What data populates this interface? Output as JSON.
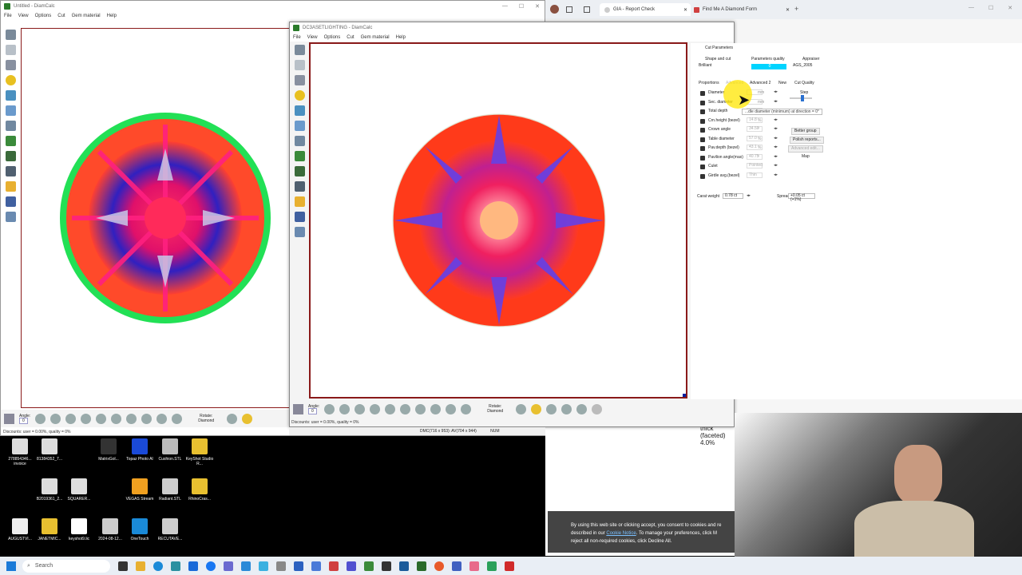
{
  "window1": {
    "title": "Untitled - DiamCalc",
    "menu": [
      "File",
      "View",
      "Options",
      "Cut",
      "Gem material",
      "Help"
    ],
    "angle_label": "Angle:",
    "angle_value": "0",
    "rotate_label": "Rotate:",
    "rotate_value": "Diamond",
    "status": "Discounts: user = 0.00%, quality = 0%"
  },
  "window2": {
    "title": "DC3ASETLIGHTING - DiamCalc",
    "menu": [
      "File",
      "View",
      "Options",
      "Cut",
      "Gem material",
      "Help"
    ],
    "angle_label": "Angle:",
    "angle_value": "0",
    "rotate_label": "Rotate:",
    "rotate_value": "Diamond",
    "status_left": "Discounts: user = 0.00%, quality = 0%",
    "status_mid": "DMC(716 x 953): AV(704 x 944)",
    "status_right": "NUM"
  },
  "panel": {
    "tab": "Cut Parameters",
    "shape_label": "Shape and cut",
    "shape_value": "Brilliant",
    "quality_label": "Parameters quality",
    "quality_value": "0",
    "appraiser_label": "Appraiser",
    "appraiser_value": "AGS_2005",
    "subtabs": [
      "Proportions",
      "Advanced",
      "Advanced 2",
      "New",
      "Cut Quality"
    ],
    "step_label": "Step",
    "rows": [
      {
        "name": "Diameter",
        "value": "",
        "unit": "mm"
      },
      {
        "name": "Sec. diameter",
        "value": "",
        "unit": "mm"
      },
      {
        "name": "Total depth",
        "value": "",
        "unit": ""
      },
      {
        "name": "Crn.height (bezel)",
        "value": "14.8",
        "unit": "%"
      },
      {
        "name": "Crown angle",
        "value": "34.50",
        "unit": "°"
      },
      {
        "name": "Table diameter",
        "value": "57.0",
        "unit": "%"
      },
      {
        "name": "Pav.depth (bezel)",
        "value": "43.1",
        "unit": "%"
      },
      {
        "name": "Pavilion angle(max)",
        "value": "40.75",
        "unit": "°"
      },
      {
        "name": "Culet",
        "value": "Pointed",
        "unit": ""
      },
      {
        "name": "Girdle avg.(bezel)",
        "value": "Thin",
        "unit": ""
      }
    ],
    "tooltip": "...dle diameter (minimum) at direction = 0°",
    "buttons": [
      "Better group",
      "Polish reports...",
      "Advanced edit...",
      "Map"
    ],
    "carat_label": "Carat weight",
    "carat_value": "0.78 ct",
    "spread_label": "Spread",
    "spread_value": "+0.05 ct (+1%)"
  },
  "browser": {
    "tabs": [
      {
        "label": "GIA - Report Check"
      },
      {
        "label": "Find Me A Diamond Form"
      }
    ],
    "girdle_text": [
      "thick",
      "(faceted)",
      "4.0%"
    ],
    "cookie_line1": "By using this web site or clicking accept, you consent to cookies and re",
    "cookie_line2_a": "described in our ",
    "cookie_link": "Cookie Notice",
    "cookie_line2_b": ". To manage your preferences, click M",
    "cookie_line3": "reject all non-required cookies, click Decline All."
  },
  "desktop": {
    "icons": [
      "278854346... invoice",
      "81384352_7...",
      "MatrixGol...",
      "Topaz Photo AI",
      "Cushion.STL",
      "KeyShot Studio R...",
      "B2019361_2...",
      "SQUARER...",
      "VEGAS Stream",
      "Radiant.STL",
      "RhinoCras...",
      "AUGUSTVI...",
      "JANETMIC...",
      "keyshot9.lic",
      "2024-08-12...",
      "OneTouch",
      "RECUTAVE..."
    ]
  },
  "taskbar": {
    "search_placeholder": "Search"
  },
  "colors": {
    "accent": "#00d4ff",
    "frame": "#8a1a1a"
  }
}
